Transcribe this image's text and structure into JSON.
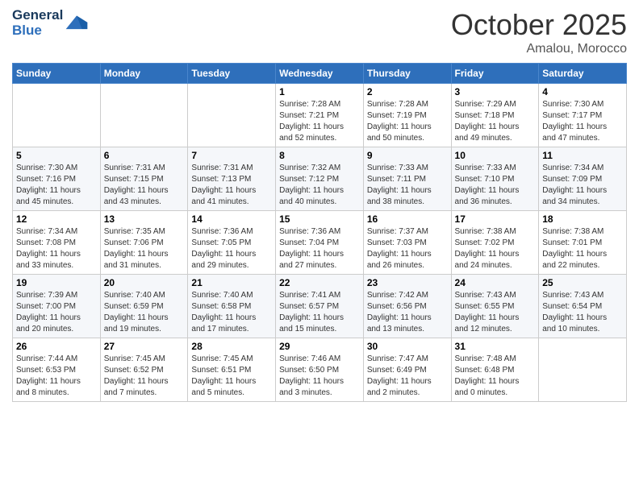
{
  "logo": {
    "text_general": "General",
    "text_blue": "Blue"
  },
  "title": {
    "month": "October 2025",
    "location": "Amalou, Morocco"
  },
  "days_header": [
    "Sunday",
    "Monday",
    "Tuesday",
    "Wednesday",
    "Thursday",
    "Friday",
    "Saturday"
  ],
  "weeks": [
    {
      "bg": "odd",
      "days": [
        {
          "number": "",
          "info": ""
        },
        {
          "number": "",
          "info": ""
        },
        {
          "number": "",
          "info": ""
        },
        {
          "number": "1",
          "info": "Sunrise: 7:28 AM\nSunset: 7:21 PM\nDaylight: 11 hours\nand 52 minutes."
        },
        {
          "number": "2",
          "info": "Sunrise: 7:28 AM\nSunset: 7:19 PM\nDaylight: 11 hours\nand 50 minutes."
        },
        {
          "number": "3",
          "info": "Sunrise: 7:29 AM\nSunset: 7:18 PM\nDaylight: 11 hours\nand 49 minutes."
        },
        {
          "number": "4",
          "info": "Sunrise: 7:30 AM\nSunset: 7:17 PM\nDaylight: 11 hours\nand 47 minutes."
        }
      ]
    },
    {
      "bg": "even",
      "days": [
        {
          "number": "5",
          "info": "Sunrise: 7:30 AM\nSunset: 7:16 PM\nDaylight: 11 hours\nand 45 minutes."
        },
        {
          "number": "6",
          "info": "Sunrise: 7:31 AM\nSunset: 7:15 PM\nDaylight: 11 hours\nand 43 minutes."
        },
        {
          "number": "7",
          "info": "Sunrise: 7:31 AM\nSunset: 7:13 PM\nDaylight: 11 hours\nand 41 minutes."
        },
        {
          "number": "8",
          "info": "Sunrise: 7:32 AM\nSunset: 7:12 PM\nDaylight: 11 hours\nand 40 minutes."
        },
        {
          "number": "9",
          "info": "Sunrise: 7:33 AM\nSunset: 7:11 PM\nDaylight: 11 hours\nand 38 minutes."
        },
        {
          "number": "10",
          "info": "Sunrise: 7:33 AM\nSunset: 7:10 PM\nDaylight: 11 hours\nand 36 minutes."
        },
        {
          "number": "11",
          "info": "Sunrise: 7:34 AM\nSunset: 7:09 PM\nDaylight: 11 hours\nand 34 minutes."
        }
      ]
    },
    {
      "bg": "odd",
      "days": [
        {
          "number": "12",
          "info": "Sunrise: 7:34 AM\nSunset: 7:08 PM\nDaylight: 11 hours\nand 33 minutes."
        },
        {
          "number": "13",
          "info": "Sunrise: 7:35 AM\nSunset: 7:06 PM\nDaylight: 11 hours\nand 31 minutes."
        },
        {
          "number": "14",
          "info": "Sunrise: 7:36 AM\nSunset: 7:05 PM\nDaylight: 11 hours\nand 29 minutes."
        },
        {
          "number": "15",
          "info": "Sunrise: 7:36 AM\nSunset: 7:04 PM\nDaylight: 11 hours\nand 27 minutes."
        },
        {
          "number": "16",
          "info": "Sunrise: 7:37 AM\nSunset: 7:03 PM\nDaylight: 11 hours\nand 26 minutes."
        },
        {
          "number": "17",
          "info": "Sunrise: 7:38 AM\nSunset: 7:02 PM\nDaylight: 11 hours\nand 24 minutes."
        },
        {
          "number": "18",
          "info": "Sunrise: 7:38 AM\nSunset: 7:01 PM\nDaylight: 11 hours\nand 22 minutes."
        }
      ]
    },
    {
      "bg": "even",
      "days": [
        {
          "number": "19",
          "info": "Sunrise: 7:39 AM\nSunset: 7:00 PM\nDaylight: 11 hours\nand 20 minutes."
        },
        {
          "number": "20",
          "info": "Sunrise: 7:40 AM\nSunset: 6:59 PM\nDaylight: 11 hours\nand 19 minutes."
        },
        {
          "number": "21",
          "info": "Sunrise: 7:40 AM\nSunset: 6:58 PM\nDaylight: 11 hours\nand 17 minutes."
        },
        {
          "number": "22",
          "info": "Sunrise: 7:41 AM\nSunset: 6:57 PM\nDaylight: 11 hours\nand 15 minutes."
        },
        {
          "number": "23",
          "info": "Sunrise: 7:42 AM\nSunset: 6:56 PM\nDaylight: 11 hours\nand 13 minutes."
        },
        {
          "number": "24",
          "info": "Sunrise: 7:43 AM\nSunset: 6:55 PM\nDaylight: 11 hours\nand 12 minutes."
        },
        {
          "number": "25",
          "info": "Sunrise: 7:43 AM\nSunset: 6:54 PM\nDaylight: 11 hours\nand 10 minutes."
        }
      ]
    },
    {
      "bg": "odd",
      "days": [
        {
          "number": "26",
          "info": "Sunrise: 7:44 AM\nSunset: 6:53 PM\nDaylight: 11 hours\nand 8 minutes."
        },
        {
          "number": "27",
          "info": "Sunrise: 7:45 AM\nSunset: 6:52 PM\nDaylight: 11 hours\nand 7 minutes."
        },
        {
          "number": "28",
          "info": "Sunrise: 7:45 AM\nSunset: 6:51 PM\nDaylight: 11 hours\nand 5 minutes."
        },
        {
          "number": "29",
          "info": "Sunrise: 7:46 AM\nSunset: 6:50 PM\nDaylight: 11 hours\nand 3 minutes."
        },
        {
          "number": "30",
          "info": "Sunrise: 7:47 AM\nSunset: 6:49 PM\nDaylight: 11 hours\nand 2 minutes."
        },
        {
          "number": "31",
          "info": "Sunrise: 7:48 AM\nSunset: 6:48 PM\nDaylight: 11 hours\nand 0 minutes."
        },
        {
          "number": "",
          "info": ""
        }
      ]
    }
  ]
}
